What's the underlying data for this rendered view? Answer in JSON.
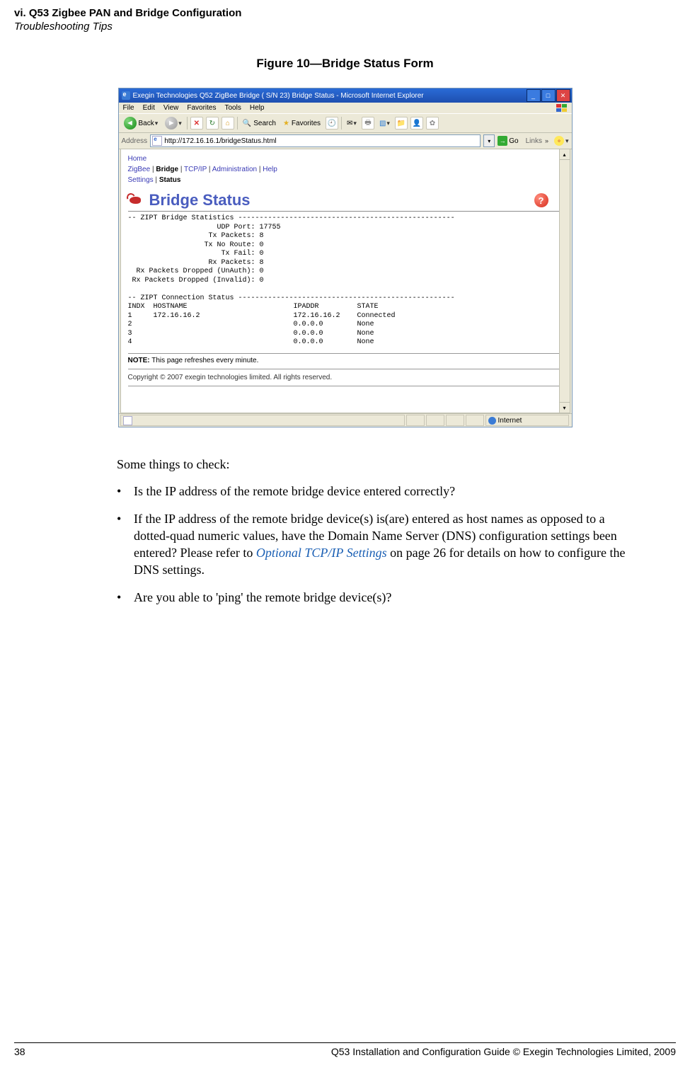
{
  "header": {
    "chapter": "vi. Q53 Zigbee PAN and Bridge Configuration",
    "section": "Troubleshooting Tips"
  },
  "figure_caption": "Figure 10—Bridge Status Form",
  "browser": {
    "window_title": "Exegin Technologies Q52 ZigBee Bridge ( S/N 23) Bridge Status - Microsoft Internet Explorer",
    "menu": {
      "file": "File",
      "edit": "Edit",
      "view": "View",
      "favorites": "Favorites",
      "tools": "Tools",
      "help": "Help"
    },
    "toolbar": {
      "back": "Back",
      "search": "Search",
      "favorites": "Favorites"
    },
    "address_label": "Address",
    "url": "http://172.16.16.1/bridgeStatus.html",
    "go_label": "Go",
    "links_label": "Links",
    "status_zone": "Internet"
  },
  "page": {
    "crumb_home": "Home",
    "crumb_l2_a": "ZigBee",
    "crumb_l2_b": "Bridge",
    "crumb_l2_c": "TCP/IP",
    "crumb_l2_d": "Administration",
    "crumb_l2_e": "Help",
    "crumb_l3_a": "Settings",
    "crumb_l3_b": "Status",
    "panel_title": "Bridge Status",
    "pre_text": "-- ZIPT Bridge Statistics ---------------------------------------------------\n                     UDP Port: 17755\n                   Tx Packets: 8\n                  Tx No Route: 0\n                      Tx Fail: 0\n                   Rx Packets: 8\n  Rx Packets Dropped (UnAuth): 0\n Rx Packets Dropped (Invalid): 0\n\n-- ZIPT Connection Status ---------------------------------------------------\nINDX  HOSTNAME                         IPADDR         STATE\n1     172.16.16.2                      172.16.16.2    Connected\n2                                      0.0.0.0        None\n3                                      0.0.0.0        None\n4                                      0.0.0.0        None",
    "note_label": "NOTE:",
    "note_text": " This page refreshes every minute.",
    "copyright": "Copyright © 2007 exegin technologies limited. All rights reserved."
  },
  "body": {
    "intro": "Some things to check:",
    "b1": "Is the IP address of the remote bridge device entered correctly?",
    "b2_a": "If the IP address of the remote bridge device(s) is(are) entered as host names as opposed to a dotted-quad numeric values, have the Domain Name Server (DNS) configuration settings been entered? Please refer to ",
    "b2_link": "Optional TCP/IP Settings",
    "b2_b": " on page 26 for details on how to configure the DNS settings.",
    "b3": "Are you able to 'ping' the remote bridge device(s)?"
  },
  "footer": {
    "page_number": "38",
    "text": "Q53 Installation and Configuration Guide  © Exegin Technologies Limited, 2009"
  }
}
